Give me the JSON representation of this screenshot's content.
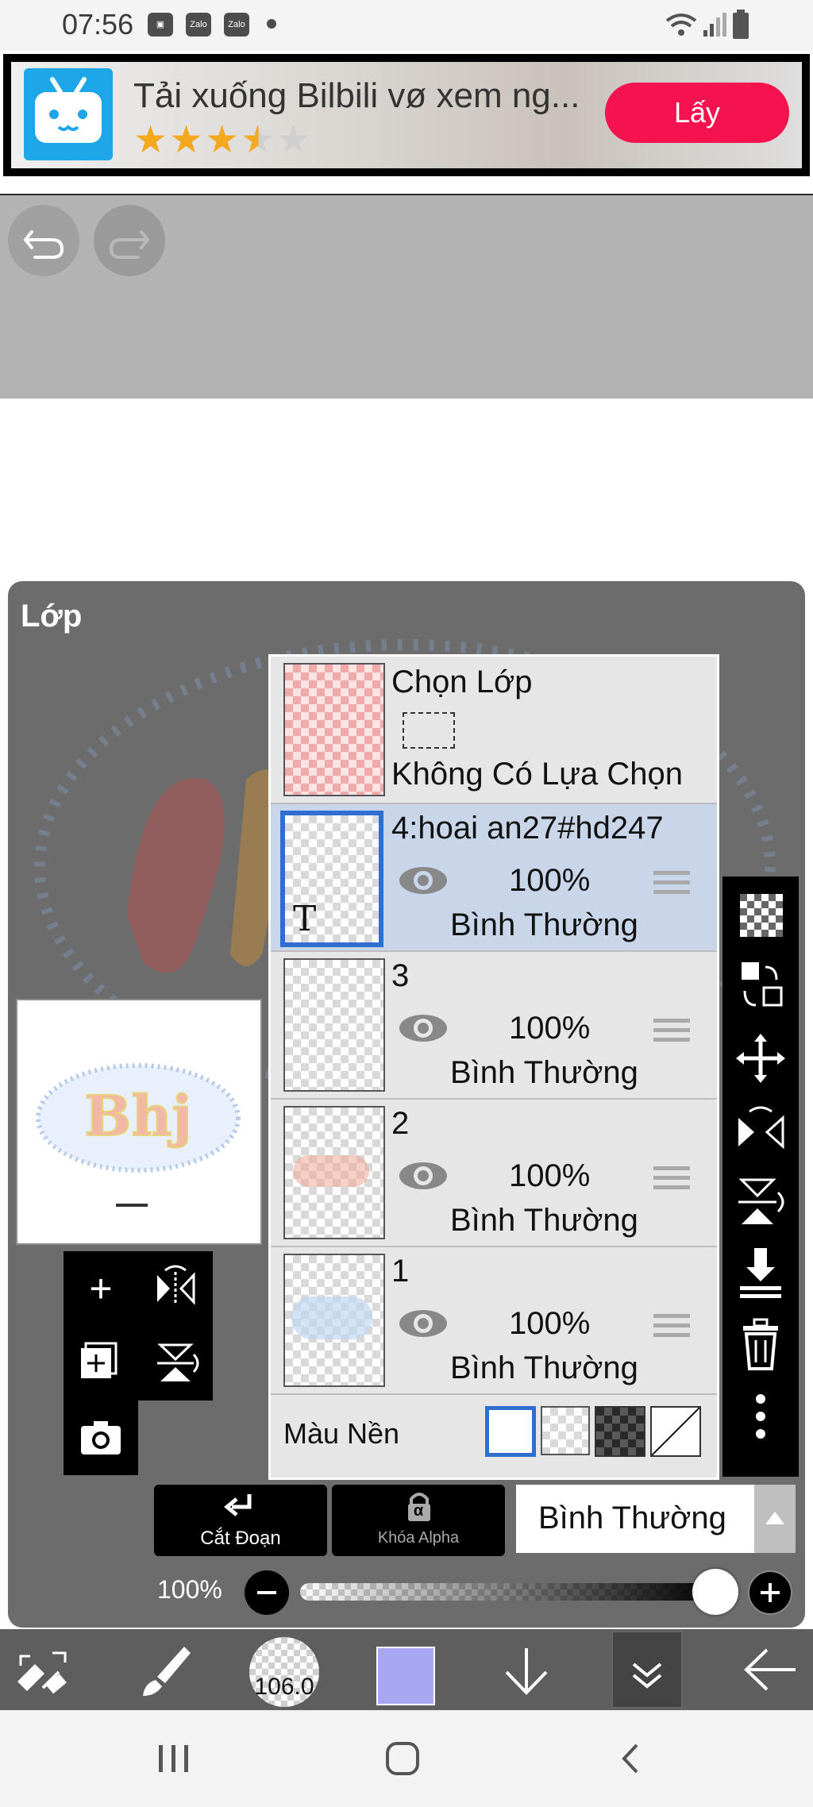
{
  "status_bar": {
    "time": "07:56",
    "notification_icons": [
      "gallery-icon",
      "zalo-icon",
      "zalo-icon",
      "dot-icon"
    ],
    "zalo_label": "Zalo",
    "system_icons": [
      "wifi-icon",
      "signal-icon",
      "battery-icon"
    ]
  },
  "ad": {
    "title": "Tải xuống Bilbili vø xem ng...",
    "rating_stars": 3.5,
    "stars_display": "★★★★★",
    "cta_label": "Lấy",
    "cta_color": "#f4134e"
  },
  "toolbar": {
    "undo_icon": "undo-icon",
    "redo_icon": "redo-icon"
  },
  "layer_panel": {
    "title": "Lớp",
    "selection_row": {
      "title": "Chọn Lớp",
      "status": "Không Có Lựa Chọn"
    },
    "layers": [
      {
        "name": "4:hoai an27#hd247",
        "opacity": "100%",
        "blend": "Bình Thường",
        "selected": true,
        "type_marker": "T"
      },
      {
        "name": "3",
        "opacity": "100%",
        "blend": "Bình Thường",
        "selected": false
      },
      {
        "name": "2",
        "opacity": "100%",
        "blend": "Bình Thường",
        "selected": false
      },
      {
        "name": "1",
        "opacity": "100%",
        "blend": "Bình Thường",
        "selected": false
      }
    ],
    "background_label": "Màu Nền",
    "selected_highlight": "#c9d6ea",
    "accent": "#2f6fd1"
  },
  "preview": {
    "art_text": "Bhj"
  },
  "bottom_controls": {
    "clip_label": "Cắt Đoạn",
    "alpha_lock_label": "Khóa Alpha",
    "alpha_symbol": "α",
    "blend_mode": "Bình Thường",
    "opacity_label": "100%",
    "opacity_value": 1.0
  },
  "bottom_bar": {
    "brush_size": "106.0",
    "color_swatch": "#a8a8f2"
  },
  "nav_bar": {
    "icons": [
      "recent-apps-icon",
      "home-icon",
      "back-icon"
    ]
  }
}
